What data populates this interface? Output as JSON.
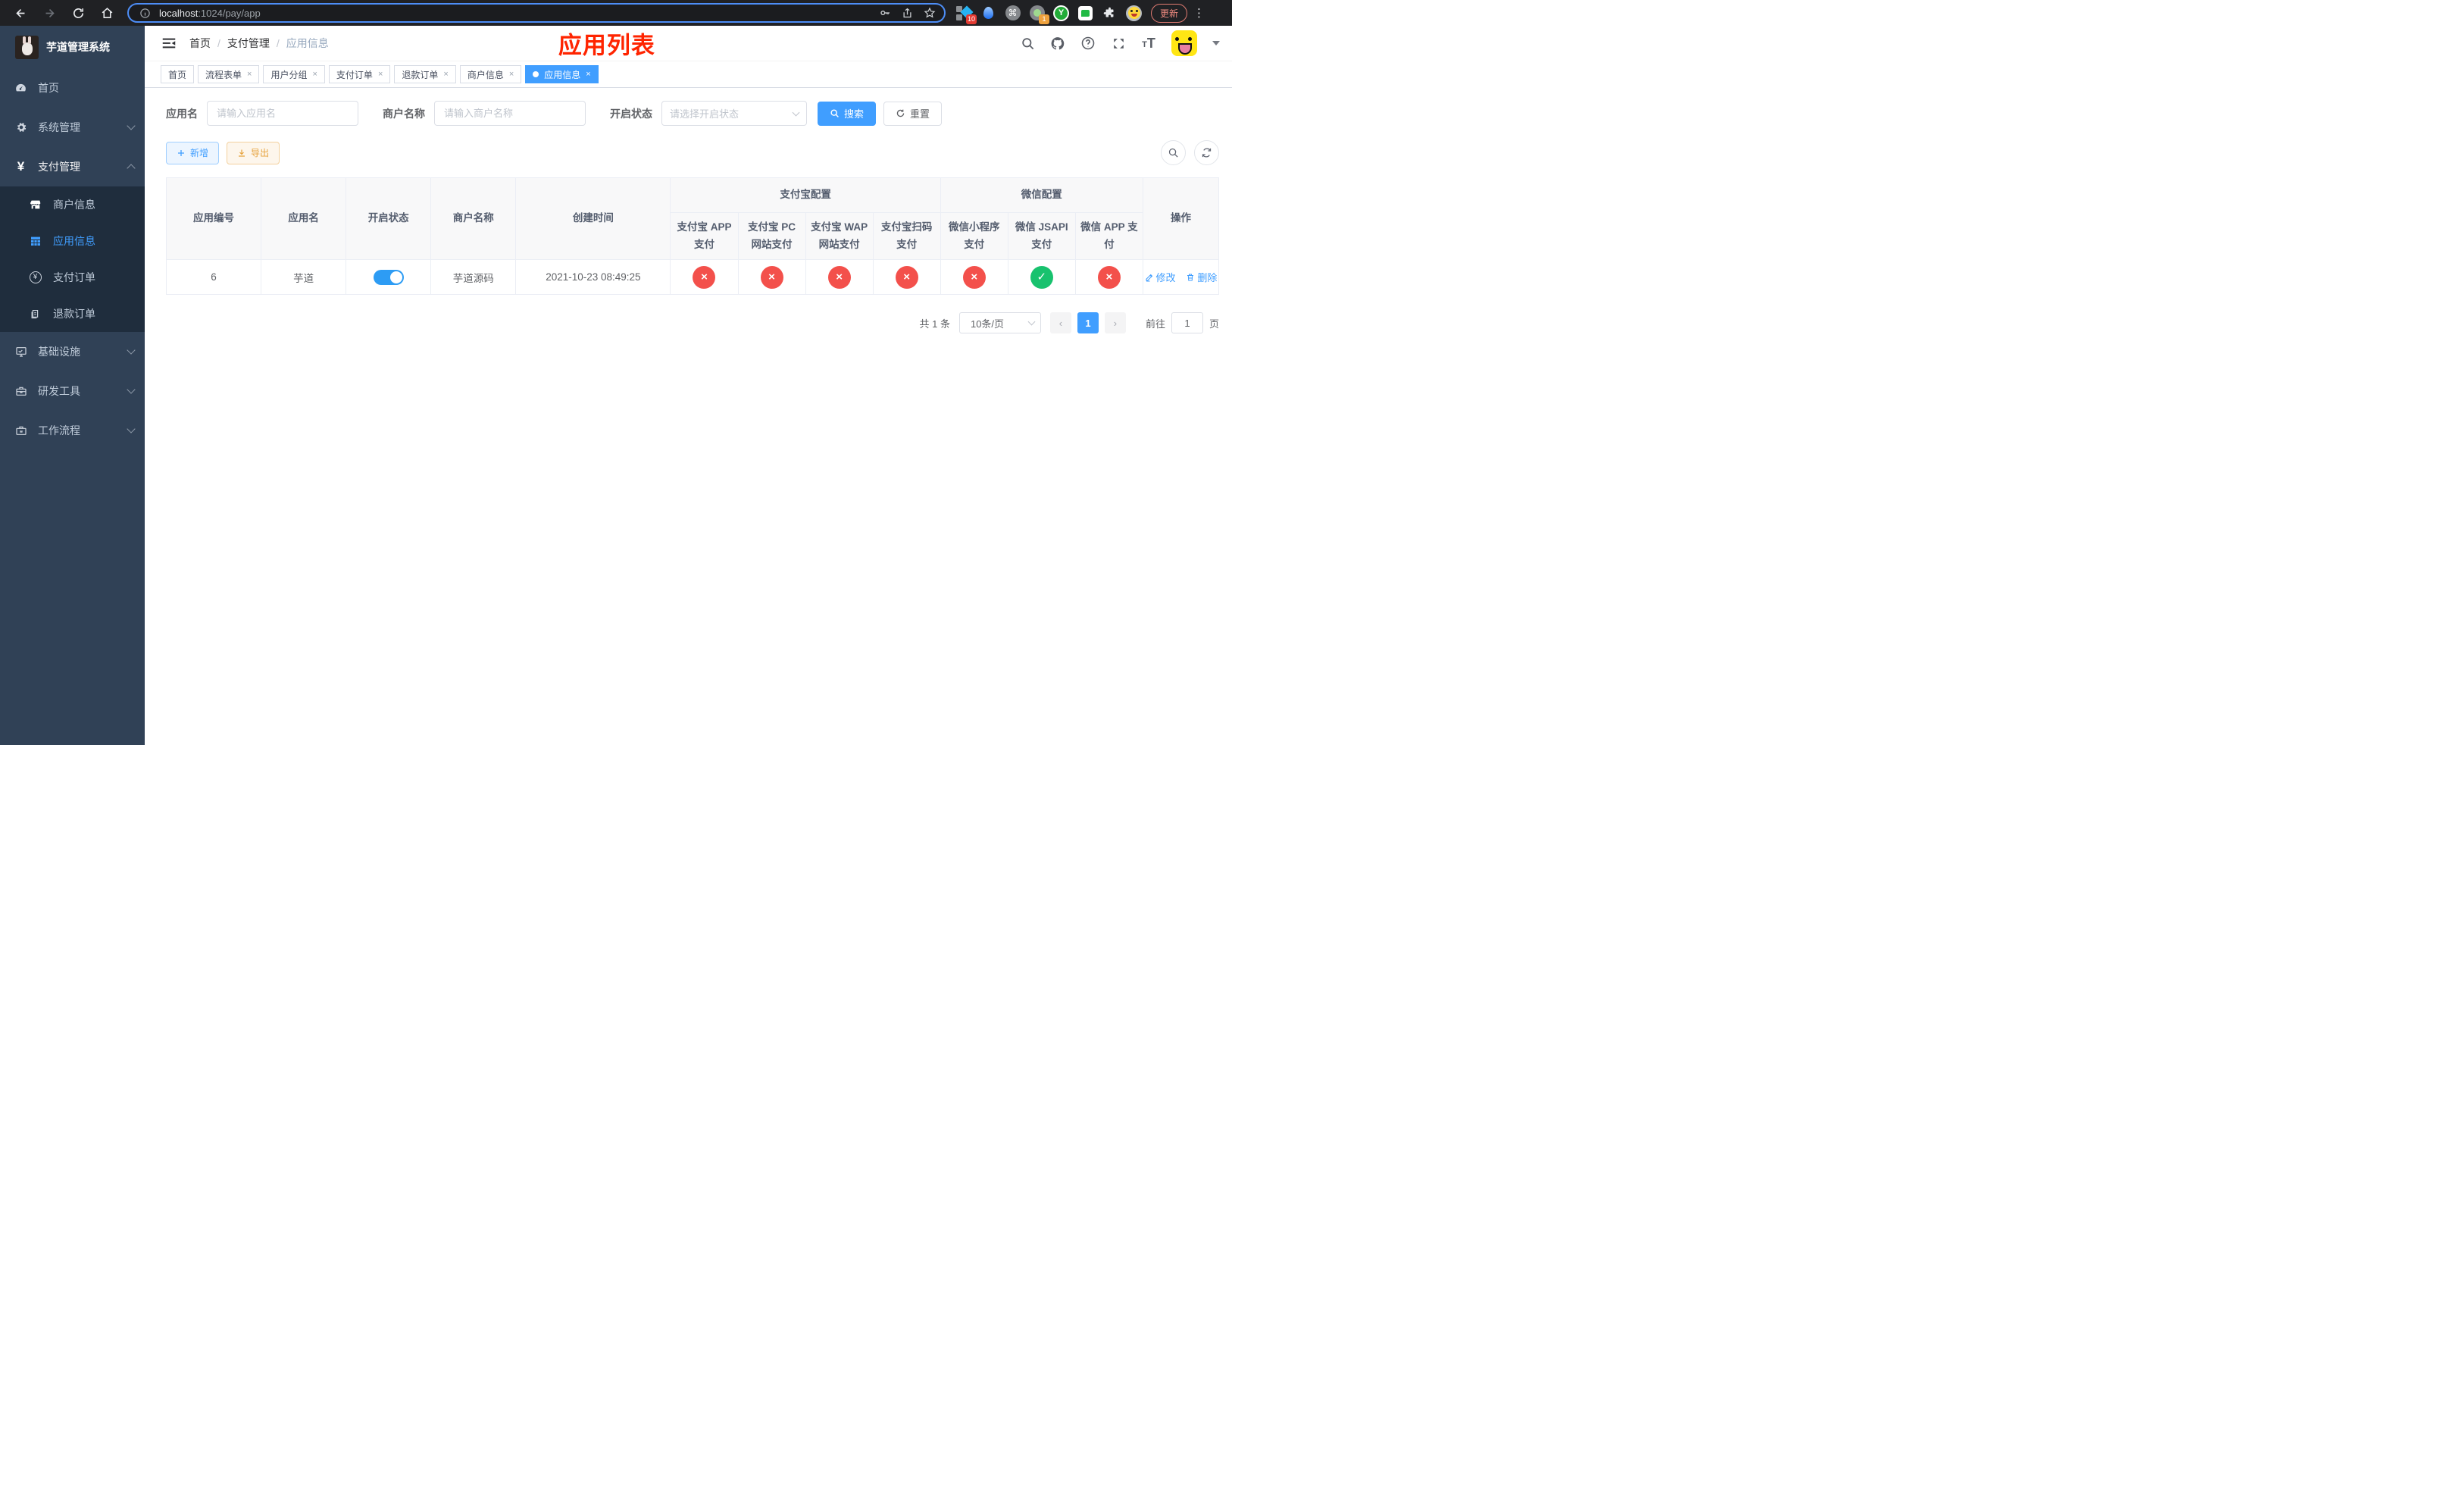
{
  "colors": {
    "accent": "#409EFF",
    "danger": "#f3504b",
    "success": "#18c26e",
    "warning": "#e6a23c",
    "title_red": "#ff2400"
  },
  "browser": {
    "url_host": "localhost",
    "url_rest": ":1024/pay/app",
    "update_label": "更新",
    "ext_badge_blue_diamond": "10",
    "ext_badge_green_dot": "1",
    "kebab": "⋮"
  },
  "sidebar": {
    "title": "芋道管理系统",
    "home": "首页",
    "system": "系统管理",
    "payment": "支付管理",
    "sub_merchant": "商户信息",
    "sub_app": "应用信息",
    "sub_pay_order": "支付订单",
    "sub_refund_order": "退款订单",
    "infra": "基础设施",
    "devtools": "研发工具",
    "workflow": "工作流程"
  },
  "breadcrumb": {
    "items": [
      "首页",
      "支付管理",
      "应用信息"
    ],
    "separator": "/"
  },
  "page_title": "应用列表",
  "tabs": [
    {
      "label": "首页"
    },
    {
      "label": "流程表单"
    },
    {
      "label": "用户分组"
    },
    {
      "label": "支付订单"
    },
    {
      "label": "退款订单"
    },
    {
      "label": "商户信息"
    },
    {
      "label": "应用信息"
    }
  ],
  "search": {
    "app_name_label": "应用名",
    "app_name_placeholder": "请输入应用名",
    "merchant_label": "商户名称",
    "merchant_placeholder": "请输入商户名称",
    "status_label": "开启状态",
    "status_placeholder": "请选择开启状态",
    "search_label": "搜索",
    "reset_label": "重置"
  },
  "toolbar": {
    "add_label": "新增",
    "export_label": "导出"
  },
  "table": {
    "headers": {
      "app_id": "应用编号",
      "app_name": "应用名",
      "status": "开启状态",
      "merchant": "商户名称",
      "created": "创建时间",
      "alipay_group": "支付宝配置",
      "wechat_group": "微信配置",
      "alipay_app": "支付宝 APP 支付",
      "alipay_pc": "支付宝 PC 网站支付",
      "alipay_wap": "支付宝 WAP 网站支付",
      "alipay_qr": "支付宝扫码支付",
      "wx_mini": "微信小程序支付",
      "wx_jsapi": "微信 JSAPI 支付",
      "wx_app": "微信 APP 支付",
      "actions": "操作"
    },
    "row": {
      "app_id": "6",
      "app_name": "芋道",
      "status_on": true,
      "merchant": "芋道源码",
      "created": "2021-10-23 08:49:25",
      "channels": [
        "fail",
        "fail",
        "fail",
        "fail",
        "fail",
        "pass",
        "fail"
      ],
      "edit_label": "修改",
      "delete_label": "删除"
    }
  },
  "icons": {
    "pass_glyph": "✓",
    "fail_glyph": "×",
    "close_glyph": "×"
  },
  "pagination": {
    "total": "共 1 条",
    "page_size": "10条/页",
    "prev": "‹",
    "next": "›",
    "current_page": "1",
    "goto_label": "前往",
    "goto_value": "1",
    "page_unit": "页"
  }
}
